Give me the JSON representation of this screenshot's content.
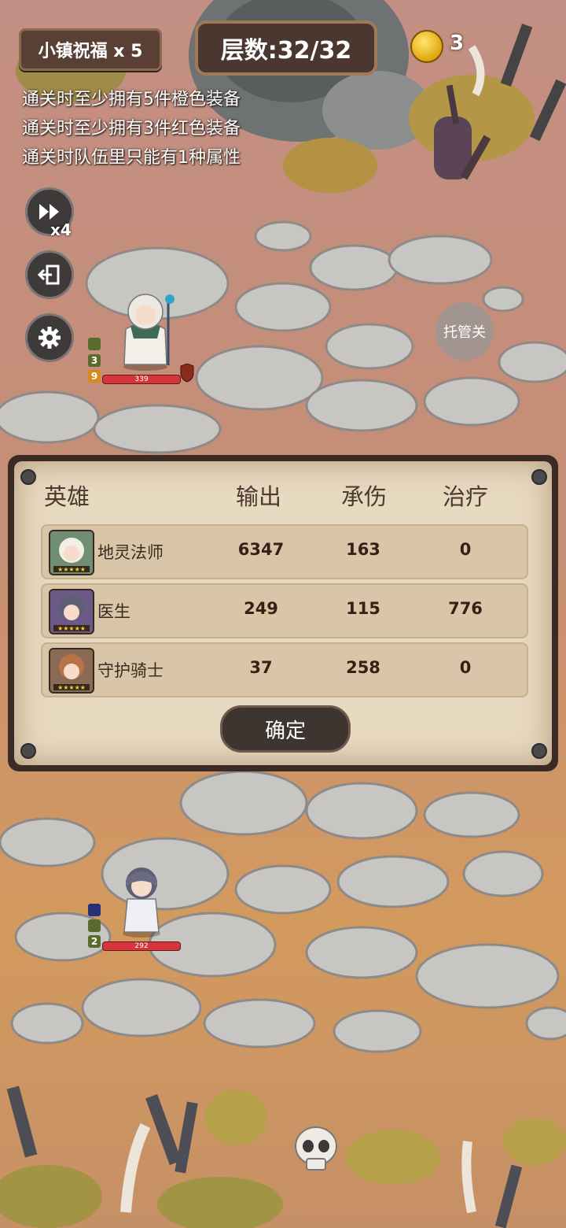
{
  "hud": {
    "blessing_label": "小镇祝福 x 5",
    "floor_label": "层数:32/32",
    "coin_count": "3",
    "speed_label": "x4",
    "auto_button_label": "托管关"
  },
  "objectives": [
    "通关时至少拥有5件橙色装备",
    "通关时至少拥有3件红色装备",
    "通关时队伍里只能有1种属性"
  ],
  "field_heroes": {
    "top": {
      "tag1": "3",
      "tag2": "9",
      "hp": "339"
    },
    "bottom": {
      "tag1": "2",
      "hp": "292"
    }
  },
  "stats_panel": {
    "headers": {
      "hero": "英雄",
      "damage": "输出",
      "taken": "承伤",
      "heal": "治疗"
    },
    "rows": [
      {
        "name": "地灵法师",
        "damage": "6347",
        "taken": "163",
        "heal": "0"
      },
      {
        "name": "医生",
        "damage": "249",
        "taken": "115",
        "heal": "776"
      },
      {
        "name": "守护骑士",
        "damage": "37",
        "taken": "258",
        "heal": "0"
      }
    ],
    "confirm_label": "确定"
  },
  "colors": {
    "ground_pink": "#c9927e",
    "ground_orange": "#d39a5e",
    "stone": "#c8c6c2",
    "panel_bg": "#e8d9c1",
    "hp_red": "#d8343b"
  },
  "icons": [
    "coin-icon",
    "fast-forward-icon",
    "exit-icon",
    "gear-icon",
    "skull-icon"
  ]
}
